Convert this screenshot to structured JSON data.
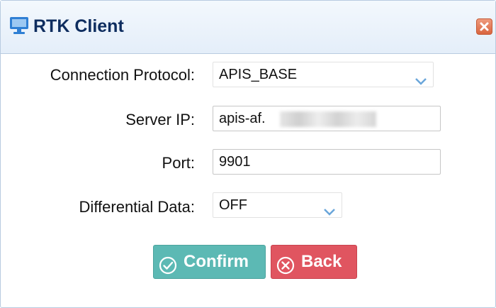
{
  "dialog": {
    "title": "RTK Client",
    "title_icon": "monitor-icon",
    "close_icon": "close-icon"
  },
  "form": {
    "protocol": {
      "label": "Connection Protocol:",
      "value": "APIS_BASE"
    },
    "server_ip": {
      "label": "Server IP:",
      "value": "apis-af."
    },
    "port": {
      "label": "Port:",
      "value": "9901"
    },
    "differential": {
      "label": "Differential Data:",
      "value": "OFF"
    }
  },
  "buttons": {
    "confirm": {
      "label": "Confirm",
      "icon": "check-circle-icon"
    },
    "back": {
      "label": "Back",
      "icon": "x-circle-icon"
    }
  },
  "colors": {
    "confirm": "#5cb9b4",
    "back": "#e05560",
    "title": "#0e2d5f",
    "accent": "#2f7fd4"
  }
}
